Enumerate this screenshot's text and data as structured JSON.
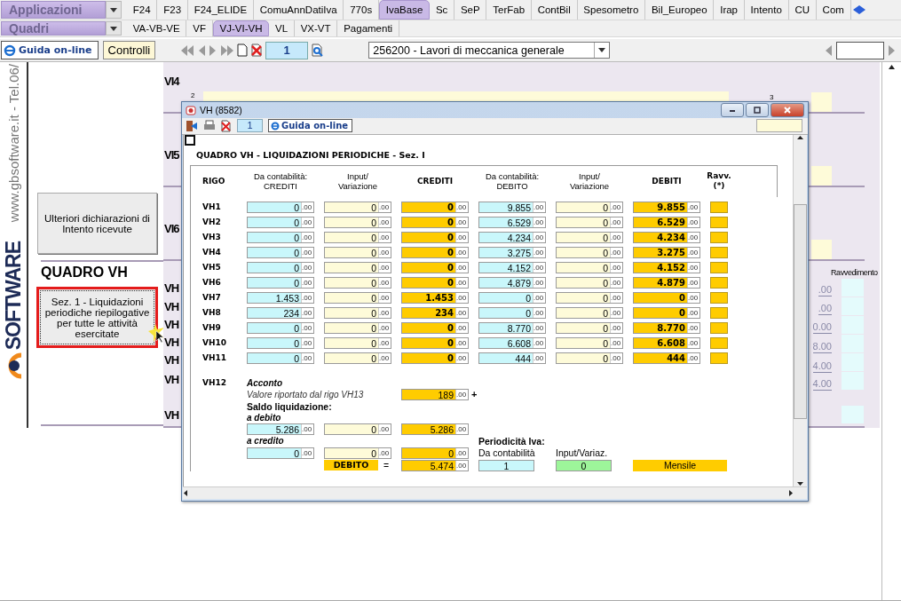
{
  "nav_rows": [
    {
      "menu": "Applicazioni",
      "tabs": [
        {
          "label": "F24",
          "selected": false
        },
        {
          "label": "F23",
          "selected": false
        },
        {
          "label": "F24_ELIDE",
          "selected": false
        },
        {
          "label": "ComuAnnDatiIva",
          "selected": false
        },
        {
          "label": "770s",
          "selected": false
        },
        {
          "label": "IvaBase",
          "selected": true
        },
        {
          "label": "Sc",
          "selected": false
        },
        {
          "label": "SeP",
          "selected": false
        },
        {
          "label": "TerFab",
          "selected": false
        },
        {
          "label": "ContBil",
          "selected": false
        },
        {
          "label": "Spesometro",
          "selected": false
        },
        {
          "label": "Bil_Europeo",
          "selected": false
        },
        {
          "label": "Irap",
          "selected": false
        },
        {
          "label": "Intento",
          "selected": false
        },
        {
          "label": "CU",
          "selected": false
        },
        {
          "label": "Com",
          "selected": false
        }
      ]
    },
    {
      "menu": "Quadri",
      "tabs": [
        {
          "label": "VA-VB-VE",
          "selected": false
        },
        {
          "label": "VF",
          "selected": false
        },
        {
          "label": "VJ-VI-VH",
          "selected": true
        },
        {
          "label": "VL",
          "selected": false
        },
        {
          "label": "VX-VT",
          "selected": false
        },
        {
          "label": "Pagamenti",
          "selected": false
        }
      ]
    }
  ],
  "toolbar": {
    "help_button": "Guida on-line",
    "check_button": "Controlli",
    "page": "1",
    "activity": "256200 - Lavori di meccanica generale"
  },
  "sidebar": {
    "website": "www.gbsoftware.it - Tel.06/",
    "logo": "SOFTWARE"
  },
  "left_panel": [
    {
      "kind": "button",
      "label": "Ulteriori dichiarazioni di Intento ricevute",
      "selected": false
    },
    {
      "kind": "heading",
      "label": "QUADRO VH"
    },
    {
      "kind": "button",
      "label": "Sez. 1 - Liquidazioni periodiche riepilogative per tutte le attività esercitate",
      "selected": true
    }
  ],
  "form": {
    "vi_rows": [
      "VI4",
      "VI5",
      "VI6"
    ],
    "column_numbers": [
      "2",
      "3"
    ],
    "vh_labels": [
      "VH",
      "VH",
      "VH",
      "VH",
      "VH",
      "VH",
      "VH"
    ],
    "ravvedimento_header": "Ravvedimento",
    "amounts": [
      ".00",
      ".00",
      "0.00",
      "8.00",
      "4.00",
      "4.00"
    ]
  },
  "dialog": {
    "title": "VH (8582)",
    "page": "1",
    "checked": false,
    "help_button": "Guida on-line",
    "heading": "QUADRO VH - LIQUIDAZIONI PERIODICHE - Sez. I",
    "columns": [
      {
        "label": "RIGO",
        "kind": "rigo"
      },
      {
        "label": "Da contabilità:\nCREDITI",
        "kind": "book"
      },
      {
        "label": "Input/\nVariazione",
        "kind": "input"
      },
      {
        "label": "CREDITI",
        "kind": "total"
      },
      {
        "label": "Da contabilità:\nDEBITO",
        "kind": "book"
      },
      {
        "label": "Input/\nVariazione",
        "kind": "input"
      },
      {
        "label": "DEBITI",
        "kind": "total"
      },
      {
        "label": "Ravv.\n(*)",
        "kind": "flag"
      }
    ],
    "rows": [
      {
        "rigo": "VH1",
        "values": [
          [
            "0",
            ".00"
          ],
          [
            "0",
            ".00"
          ],
          [
            "0",
            ".00"
          ],
          [
            "9.855",
            ".00"
          ],
          [
            "0",
            ".00"
          ],
          [
            "9.855",
            ".00"
          ]
        ]
      },
      {
        "rigo": "VH2",
        "values": [
          [
            "0",
            ".00"
          ],
          [
            "0",
            ".00"
          ],
          [
            "0",
            ".00"
          ],
          [
            "6.529",
            ".00"
          ],
          [
            "0",
            ".00"
          ],
          [
            "6.529",
            ".00"
          ]
        ]
      },
      {
        "rigo": "VH3",
        "values": [
          [
            "0",
            ".00"
          ],
          [
            "0",
            ".00"
          ],
          [
            "0",
            ".00"
          ],
          [
            "4.234",
            ".00"
          ],
          [
            "0",
            ".00"
          ],
          [
            "4.234",
            ".00"
          ]
        ]
      },
      {
        "rigo": "VH4",
        "values": [
          [
            "0",
            ".00"
          ],
          [
            "0",
            ".00"
          ],
          [
            "0",
            ".00"
          ],
          [
            "3.275",
            ".00"
          ],
          [
            "0",
            ".00"
          ],
          [
            "3.275",
            ".00"
          ]
        ]
      },
      {
        "rigo": "VH5",
        "values": [
          [
            "0",
            ".00"
          ],
          [
            "0",
            ".00"
          ],
          [
            "0",
            ".00"
          ],
          [
            "4.152",
            ".00"
          ],
          [
            "0",
            ".00"
          ],
          [
            "4.152",
            ".00"
          ]
        ]
      },
      {
        "rigo": "VH6",
        "values": [
          [
            "0",
            ".00"
          ],
          [
            "0",
            ".00"
          ],
          [
            "0",
            ".00"
          ],
          [
            "4.879",
            ".00"
          ],
          [
            "0",
            ".00"
          ],
          [
            "4.879",
            ".00"
          ]
        ]
      },
      {
        "rigo": "VH7",
        "values": [
          [
            "1.453",
            ".00"
          ],
          [
            "0",
            ".00"
          ],
          [
            "1.453",
            ".00"
          ],
          [
            "0",
            ".00"
          ],
          [
            "0",
            ".00"
          ],
          [
            "0",
            ".00"
          ]
        ]
      },
      {
        "rigo": "VH8",
        "values": [
          [
            "234",
            ".00"
          ],
          [
            "0",
            ".00"
          ],
          [
            "234",
            ".00"
          ],
          [
            "0",
            ".00"
          ],
          [
            "0",
            ".00"
          ],
          [
            "0",
            ".00"
          ]
        ]
      },
      {
        "rigo": "VH9",
        "values": [
          [
            "0",
            ".00"
          ],
          [
            "0",
            ".00"
          ],
          [
            "0",
            ".00"
          ],
          [
            "8.770",
            ".00"
          ],
          [
            "0",
            ".00"
          ],
          [
            "8.770",
            ".00"
          ]
        ]
      },
      {
        "rigo": "VH10",
        "values": [
          [
            "0",
            ".00"
          ],
          [
            "0",
            ".00"
          ],
          [
            "0",
            ".00"
          ],
          [
            "6.608",
            ".00"
          ],
          [
            "0",
            ".00"
          ],
          [
            "6.608",
            ".00"
          ]
        ]
      },
      {
        "rigo": "VH11",
        "values": [
          [
            "0",
            ".00"
          ],
          [
            "0",
            ".00"
          ],
          [
            "0",
            ".00"
          ],
          [
            "444",
            ".00"
          ],
          [
            "0",
            ".00"
          ],
          [
            "444",
            ".00"
          ]
        ]
      }
    ],
    "acconto": {
      "rigo": "VH12",
      "title": "Acconto",
      "note": "Valore riportato dal rigo VH13",
      "value": [
        "189",
        ".00"
      ],
      "sign": "+"
    },
    "saldo": {
      "title": "Saldo liquidazione:",
      "lines": [
        {
          "label": "a debito",
          "values": [
            [
              "5.286",
              ".00"
            ],
            [
              "0",
              ".00"
            ],
            [
              "5.286",
              ".00"
            ]
          ]
        },
        {
          "label": "a credito",
          "values": [
            [
              "0",
              ".00"
            ],
            [
              "0",
              ".00"
            ],
            [
              "0",
              ".00"
            ]
          ]
        }
      ]
    },
    "periodicita": {
      "title": "Periodicità Iva:",
      "book_label": "Da contabilità",
      "input_label": "Input/Variaz.",
      "book_value": "1",
      "input_value": "0",
      "result": "Mensile"
    },
    "result": {
      "label": "DEBITO",
      "equals": "=",
      "value": [
        "5.474",
        ".00"
      ]
    }
  }
}
